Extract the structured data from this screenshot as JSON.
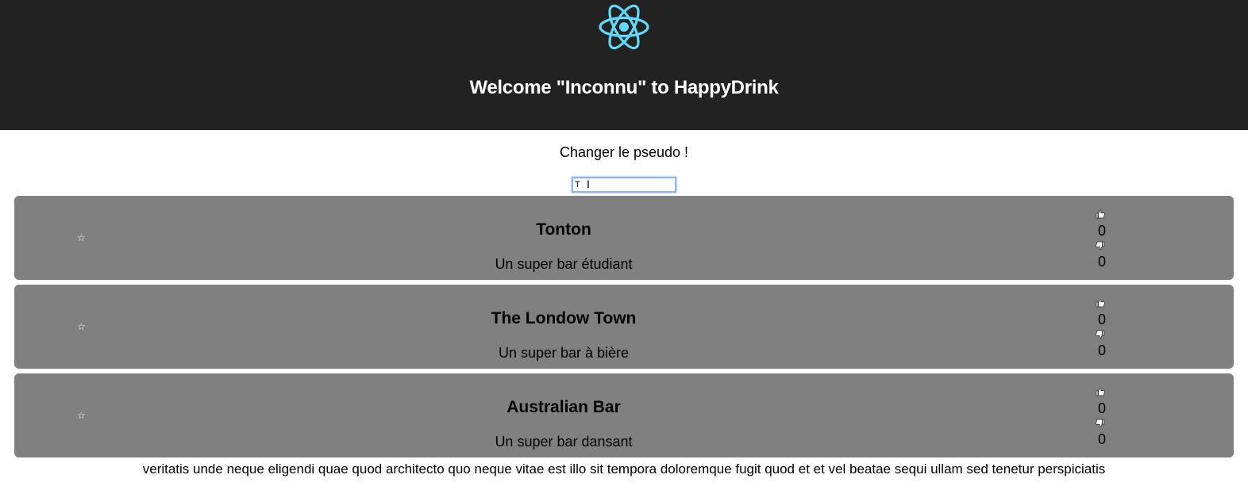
{
  "header": {
    "logo_icon": "react-atom-icon",
    "logo_color": "#61dafb",
    "background": "#222222",
    "title": "Welcome \"Inconnu\" to HappyDrink"
  },
  "pseudo": {
    "label": "Changer le pseudo !",
    "input_value": "T"
  },
  "bars": [
    {
      "name": "Tonton",
      "description": "Un super bar étudiant",
      "likes": "0",
      "dislikes": "0",
      "favorite_icon": "star-outline-icon"
    },
    {
      "name": "The Londow Town",
      "description": "Un super bar à bière",
      "likes": "0",
      "dislikes": "0",
      "favorite_icon": "star-outline-icon"
    },
    {
      "name": "Australian Bar",
      "description": "Un super bar dansant",
      "likes": "0",
      "dislikes": "0",
      "favorite_icon": "star-outline-icon"
    }
  ],
  "card_color": "#808080",
  "icons": {
    "favorite": "☆",
    "like": "thumbs-up-icon",
    "dislike": "thumbs-down-icon"
  },
  "footer": {
    "text": "veritatis unde neque eligendi quae quod architecto quo neque vitae est illo sit tempora doloremque fugit quod et et vel beatae sequi ullam sed tenetur perspiciatis"
  }
}
